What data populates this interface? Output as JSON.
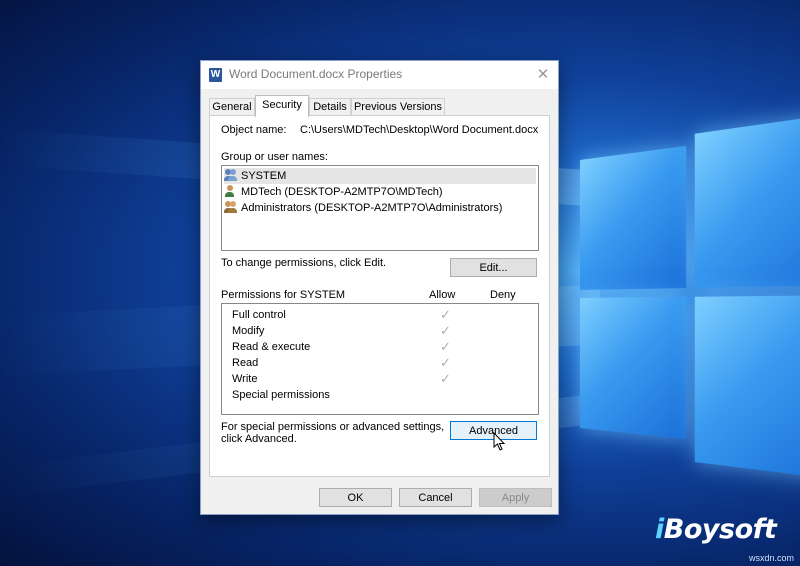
{
  "dialog": {
    "title": "Word Document.docx Properties",
    "close_glyph": "✕",
    "tabs": [
      {
        "label": "General",
        "active": false
      },
      {
        "label": "Security",
        "active": true
      },
      {
        "label": "Details",
        "active": false
      },
      {
        "label": "Previous Versions",
        "active": false
      }
    ],
    "object_name_label": "Object name:",
    "object_name_value": "C:\\Users\\MDTech\\Desktop\\Word Document.docx",
    "group_label": "Group or user names:",
    "users": [
      {
        "name": "SYSTEM",
        "icon": "group-users-icon",
        "selected": true
      },
      {
        "name": "MDTech (DESKTOP-A2MTP7O\\MDTech)",
        "icon": "user-icon",
        "selected": false
      },
      {
        "name": "Administrators (DESKTOP-A2MTP7O\\Administrators)",
        "icon": "group-users-icon",
        "selected": false
      }
    ],
    "change_text": "To change permissions, click Edit.",
    "edit_button": "Edit...",
    "permissions_header": "Permissions for SYSTEM",
    "allow_header": "Allow",
    "deny_header": "Deny",
    "permissions": [
      {
        "name": "Full control",
        "allow": true,
        "deny": false
      },
      {
        "name": "Modify",
        "allow": true,
        "deny": false
      },
      {
        "name": "Read & execute",
        "allow": true,
        "deny": false
      },
      {
        "name": "Read",
        "allow": true,
        "deny": false
      },
      {
        "name": "Write",
        "allow": true,
        "deny": false
      },
      {
        "name": "Special permissions",
        "allow": false,
        "deny": false
      }
    ],
    "check_glyph": "✓",
    "special_text_line1": "For special permissions or advanced settings,",
    "special_text_line2": "click Advanced.",
    "advanced_button": "Advanced",
    "ok_button": "OK",
    "cancel_button": "Cancel",
    "apply_button": "Apply",
    "word_icon_letter": "W"
  },
  "watermark": {
    "prefix": "i",
    "rest": "Boysoft"
  },
  "corner_text": "wsxdn.com",
  "colors": {
    "accent": "#0078d7",
    "word_blue": "#2b579a",
    "desktop_blue": "#0f3f98"
  }
}
